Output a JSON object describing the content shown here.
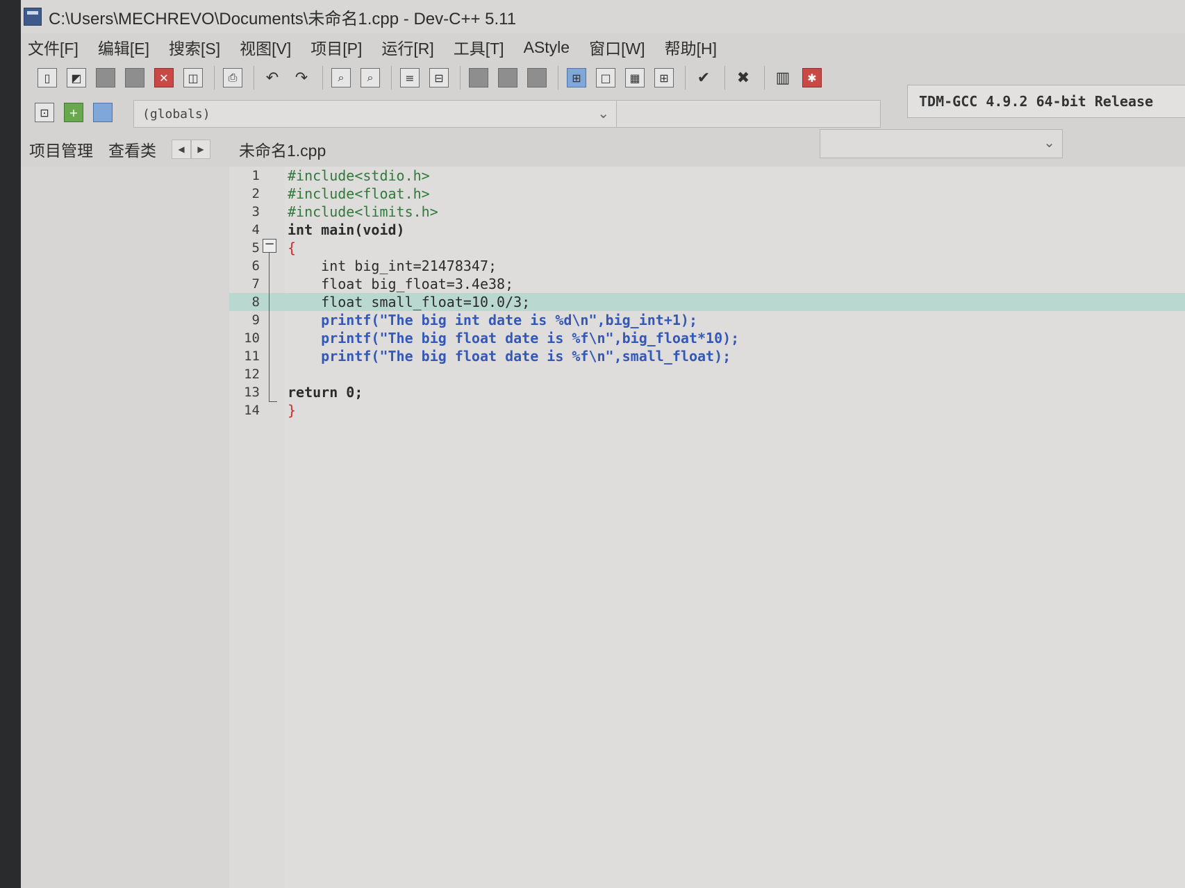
{
  "window": {
    "title": "C:\\Users\\MECHREVO\\Documents\\未命名1.cpp - Dev-C++ 5.11"
  },
  "menu": [
    "文件[F]",
    "编辑[E]",
    "搜索[S]",
    "视图[V]",
    "项目[P]",
    "运行[R]",
    "工具[T]",
    "AStyle",
    "窗口[W]",
    "帮助[H]"
  ],
  "toolbar": {
    "compiler": "TDM-GCC 4.9.2 64-bit Release",
    "scope_select": "(globals)"
  },
  "left_panel": {
    "tabs": [
      "项目管理",
      "查看类"
    ]
  },
  "editor": {
    "file_tab": "未命名1.cpp",
    "current_line": 8,
    "line_numbers": [
      "1",
      "2",
      "3",
      "4",
      "5",
      "6",
      "7",
      "8",
      "9",
      "10",
      "11",
      "12",
      "13",
      "14"
    ],
    "lines": [
      "#include<stdio.h>",
      "#include<float.h>",
      "#include<limits.h>",
      "int main(void)",
      "{",
      "    int big_int=21478347;",
      "    float big_float=3.4e38;",
      "    float small_float=10.0/3;",
      "    printf(\"The big int date is %d\\n\",big_int+1);",
      "    printf(\"The big float date is %f\\n\",big_float*10);",
      "    printf(\"The big float date is %f\\n\",small_float);",
      "",
      "return 0;",
      "}"
    ]
  }
}
